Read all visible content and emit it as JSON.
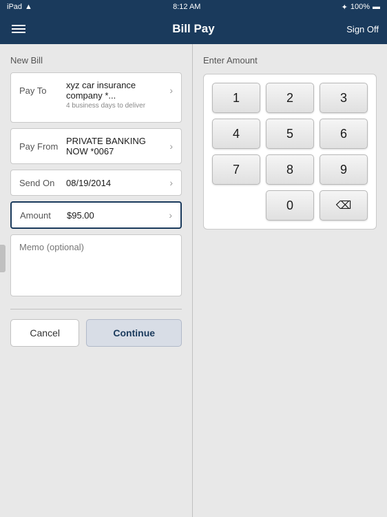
{
  "statusBar": {
    "carrier": "iPad",
    "wifi_icon": "wifi",
    "time": "8:12 AM",
    "bluetooth_icon": "bluetooth",
    "battery_percent": "100%",
    "battery_icon": "battery-full"
  },
  "navBar": {
    "title": "Bill Pay",
    "menu_icon": "hamburger-menu",
    "signoff_label": "Sign Off"
  },
  "leftPanel": {
    "section_label": "New Bill",
    "payTo": {
      "label": "Pay To",
      "value": "xyz car insurance company *...",
      "sub_text": "4 business days to deliver"
    },
    "payFrom": {
      "label": "Pay From",
      "value": "PRIVATE BANKING NOW *0067"
    },
    "sendOn": {
      "label": "Send On",
      "value": "08/19/2014"
    },
    "amount": {
      "label": "Amount",
      "value": "$95.00"
    },
    "memo": {
      "placeholder": "Memo (optional)"
    },
    "cancelButton": "Cancel",
    "continueButton": "Continue"
  },
  "rightPanel": {
    "section_label": "Enter Amount",
    "numpad": {
      "keys": [
        "1",
        "2",
        "3",
        "4",
        "5",
        "6",
        "7",
        "8",
        "9",
        "",
        "0",
        "⌫"
      ]
    }
  }
}
